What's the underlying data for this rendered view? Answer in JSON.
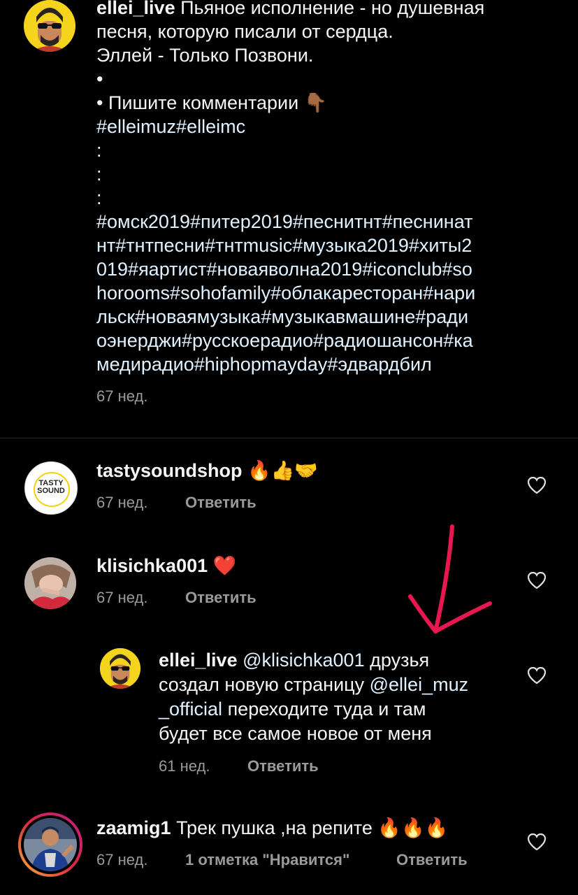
{
  "post": {
    "username": "ellei_live",
    "caption_lines": [
      "Пьяное исполнение - но душевная",
      "песня, которую писали от сердца.",
      "Эллей - Только Позвони.",
      "•",
      "• Пишите комментарии 👇🏾",
      "#elleimuz#elleimc",
      ":",
      ":",
      ":",
      "#омск2019#питер2019#песнитнт#песнинат",
      "нт#тнтпесни#тнтmusic#музыка2019#хиты2",
      "019#яартист#новаяволна2019#iconclub#so",
      "horooms#sohofamily#облакаресторан#нари",
      "льск#новаямузыка#музыкавмашине#ради",
      "оэнерджи#русскоерадио#радиошансон#ка",
      "медирадио#hiphopmayday#эдвардбил"
    ],
    "time": "67 нед."
  },
  "comments": [
    {
      "username": "tastysoundshop",
      "text": "🔥👍🤝",
      "time": "67 нед.",
      "reply_label": "Ответить",
      "avatar_text": [
        "TASTY",
        "SOUND"
      ]
    },
    {
      "username": "klisichka001",
      "text": "❤️",
      "time": "67 нед.",
      "reply_label": "Ответить"
    },
    {
      "username": "ellei_live",
      "mention1": "@klisichka001",
      "text_a": " друзья",
      "line2": "создал новую страницу ",
      "mention2a": "@ellei_muz",
      "mention2b": "_official",
      "line3": " переходите туда и там",
      "line4": "будет все самое новое от меня",
      "time": "61 нед.",
      "reply_label": "Ответить"
    },
    {
      "username": "zaamig1",
      "text": "Трек пушка ,на репите 🔥🔥🔥",
      "time": "67 нед.",
      "likes": "1 отметка \"Нравится\"",
      "reply_label": "Ответить"
    }
  ],
  "colors": {
    "background": "#000000",
    "text": "#f5f5f5",
    "meta": "#9a9a9a",
    "arrow": "#e8174f"
  }
}
